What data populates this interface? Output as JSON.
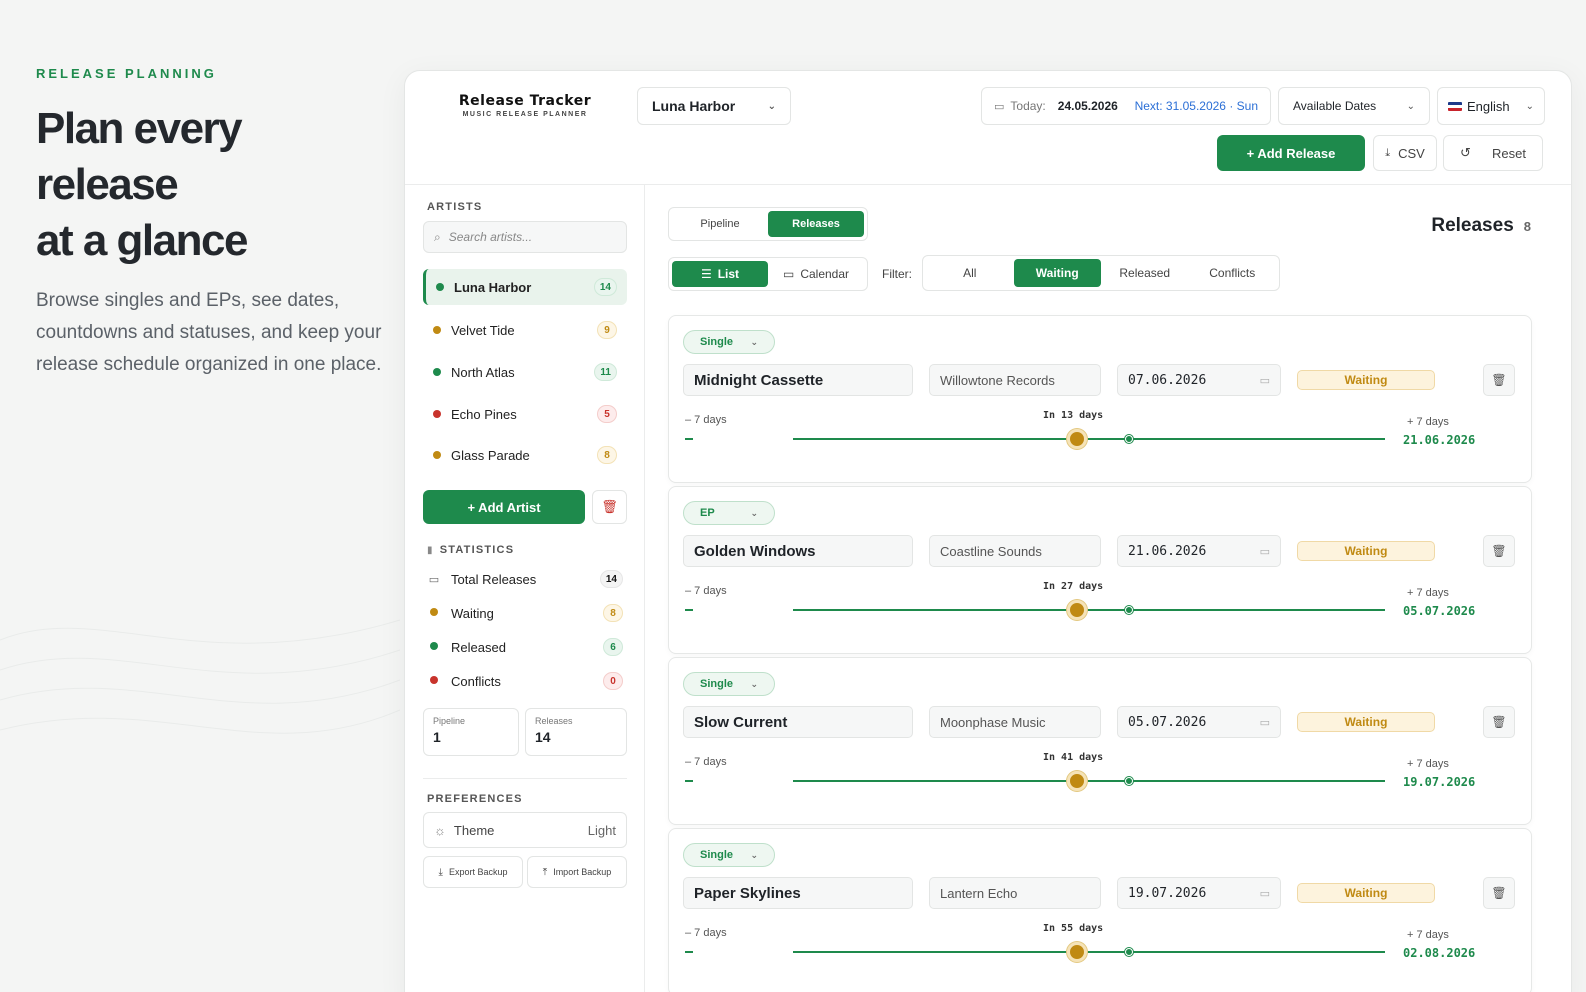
{
  "hero": {
    "eyebrow": "RELEASE PLANNING",
    "title_line1": "Plan every release",
    "title_line2": "at a glance",
    "description": "Browse singles and EPs, see dates, countdowns and statuses, and keep your release schedule organized in one place."
  },
  "app": {
    "logo_title": "Release Tracker",
    "logo_subtitle": "MUSIC RELEASE PLANNER",
    "artist_select": "Luna Harbor",
    "today_label": "Today:",
    "today_value": "24.05.2026",
    "next_value": "Next: 31.05.2026 · Sun",
    "dates_select": "Available Dates",
    "language": "English",
    "add_release_label": "+ Add Release",
    "csv_label": "CSV",
    "reset_label": "Reset"
  },
  "sidebar": {
    "artists_label": "ARTISTS",
    "search_placeholder": "Search artists...",
    "artists": [
      {
        "name": "Luna Harbor",
        "count": "14",
        "color": "#1e8a4c",
        "tone": "green"
      },
      {
        "name": "Velvet Tide",
        "count": "9",
        "color": "#c08a13",
        "tone": "amber"
      },
      {
        "name": "North Atlas",
        "count": "11",
        "color": "#1e8a4c",
        "tone": "green"
      },
      {
        "name": "Echo Pines",
        "count": "5",
        "color": "#c8332c",
        "tone": "red"
      },
      {
        "name": "Glass Parade",
        "count": "8",
        "color": "#c08a13",
        "tone": "amber"
      }
    ],
    "add_artist_label": "+ Add Artist",
    "statistics_label": "STATISTICS",
    "stats": [
      {
        "label": "Total Releases",
        "value": "14"
      },
      {
        "label": "Waiting",
        "value": "8"
      },
      {
        "label": "Released",
        "value": "6"
      },
      {
        "label": "Conflicts",
        "value": "0"
      }
    ],
    "pipeline_label": "Pipeline",
    "pipeline_value": "1",
    "releases_label": "Releases",
    "releases_value": "14",
    "preferences_label": "PREFERENCES",
    "theme_label": "Theme",
    "theme_value": "Light",
    "export_label": "Export Backup",
    "import_label": "Import Backup"
  },
  "main": {
    "tabs": [
      "Pipeline",
      "Releases"
    ],
    "heading": "Releases",
    "heading_count": "8",
    "view_modes": [
      "List",
      "Calendar"
    ],
    "filter_label": "Filter:",
    "filters": [
      "All",
      "Waiting",
      "Released",
      "Conflicts"
    ],
    "releases": [
      {
        "type": "Single",
        "title": "Midnight Cassette",
        "label": "Willowtone Records",
        "date": "07.06.2026",
        "status": "Waiting",
        "minus": "– 7 days",
        "countdown": "In 13 days",
        "plus": "+ 7 days",
        "plus_date": "21.06.2026"
      },
      {
        "type": "EP",
        "title": "Golden Windows",
        "label": "Coastline Sounds",
        "date": "21.06.2026",
        "status": "Waiting",
        "minus": "– 7 days",
        "countdown": "In 27 days",
        "plus": "+ 7 days",
        "plus_date": "05.07.2026"
      },
      {
        "type": "Single",
        "title": "Slow Current",
        "label": "Moonphase Music",
        "date": "05.07.2026",
        "status": "Waiting",
        "minus": "– 7 days",
        "countdown": "In 41 days",
        "plus": "+ 7 days",
        "plus_date": "19.07.2026"
      },
      {
        "type": "Single",
        "title": "Paper Skylines",
        "label": "Lantern Echo",
        "date": "19.07.2026",
        "status": "Waiting",
        "minus": "– 7 days",
        "countdown": "In 55 days",
        "plus": "+ 7 days",
        "plus_date": "02.08.2026"
      }
    ]
  },
  "colors": {
    "accent": "#1e8a4c",
    "waiting": "#c08a13",
    "conflict": "#c8332c",
    "next_date": "#2b6fd6"
  }
}
